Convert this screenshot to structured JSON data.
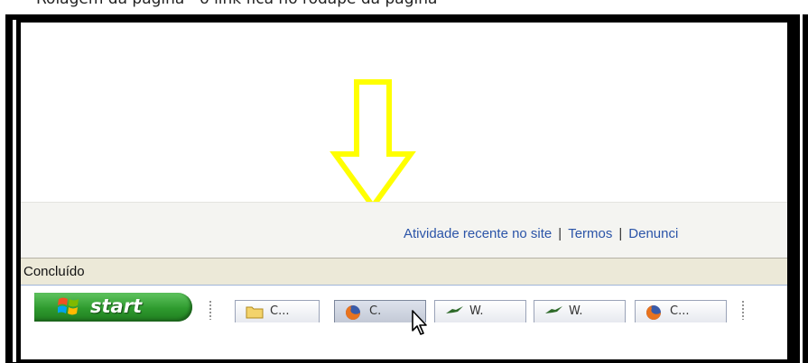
{
  "caption": {
    "text": "Rolagem da página - o link fica no rodapé da página"
  },
  "footer": {
    "links": [
      {
        "label": "Atividade recente no site"
      },
      {
        "label": "Termos"
      },
      {
        "label": "Denunci"
      }
    ],
    "separator": "|"
  },
  "status_bar": {
    "text": "Concluído"
  },
  "taskbar": {
    "start_label": "start",
    "buttons": [
      {
        "label": "C...",
        "icon": "folder-icon",
        "active": false
      },
      {
        "label": "C.",
        "icon": "firefox-icon",
        "active": true
      },
      {
        "label": "W.",
        "icon": "wikidot-icon",
        "active": false
      },
      {
        "label": "W.",
        "icon": "wikidot-icon",
        "active": false
      },
      {
        "label": "C...",
        "icon": "firefox-icon",
        "active": false
      }
    ]
  },
  "colors": {
    "annotation_arrow": "#ffff00",
    "link": "#2b54a8",
    "start_button": "#2e9a2e"
  }
}
